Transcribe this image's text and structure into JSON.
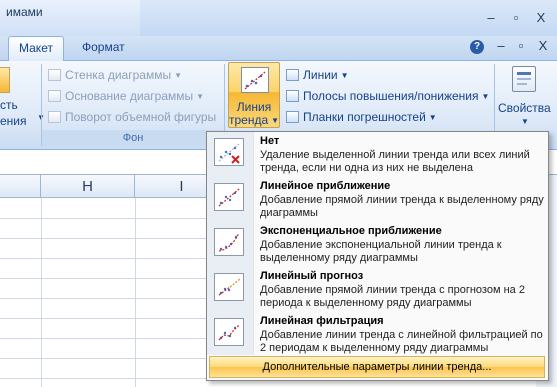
{
  "window": {
    "title": "имами",
    "controls": [
      "–",
      "▫",
      "X"
    ]
  },
  "tabs": [
    {
      "label": "Макет",
      "active": true
    },
    {
      "label": "Формат",
      "active": false
    }
  ],
  "doc_controls": [
    "–",
    "▫",
    "X"
  ],
  "ribbon": {
    "fon_group": {
      "partial_top": "сть",
      "partial_bottom": "ения",
      "items": [
        {
          "label": "Стенка диаграммы",
          "disabled": true
        },
        {
          "label": "Основание диаграммы",
          "disabled": true
        },
        {
          "label": "Поворот объемной фигуры",
          "disabled": true
        }
      ],
      "group_label": "Фон"
    },
    "trend_button": {
      "line1": "Линия",
      "line2": "тренда"
    },
    "analysis_items": [
      {
        "label": "Линии"
      },
      {
        "label": "Полосы повышения/понижения"
      },
      {
        "label": "Планки погрешностей"
      }
    ],
    "properties_label": "Свойства"
  },
  "grid": {
    "columns": [
      "H",
      "I"
    ]
  },
  "menu": {
    "items": [
      {
        "title": "Нет",
        "desc": "Удаление выделенной линии тренда или всех линий тренда, если ни одна из них не выделена",
        "icon": "trend-none-icon"
      },
      {
        "title": "Линейное приближение",
        "desc": "Добавление прямой линии тренда к выделенному ряду диаграммы",
        "icon": "trend-linear-icon"
      },
      {
        "title": "Экспоненциальное приближение",
        "desc": "Добавление экспоненциальной линии тренда к выделенному ряду диаграммы",
        "icon": "trend-exponential-icon"
      },
      {
        "title": "Линейный прогноз",
        "desc": "Добавление прямой линии тренда с прогнозом на 2 периода к выделенному ряду диаграммы",
        "icon": "trend-forecast-icon"
      },
      {
        "title": "Линейная фильтрация",
        "desc": "Добавление линии тренда с линейной фильтрацией по 2 периодам к выделенному ряду диаграммы",
        "icon": "trend-moving-average-icon"
      }
    ],
    "footer": "Дополнительные параметры линии тренда..."
  }
}
